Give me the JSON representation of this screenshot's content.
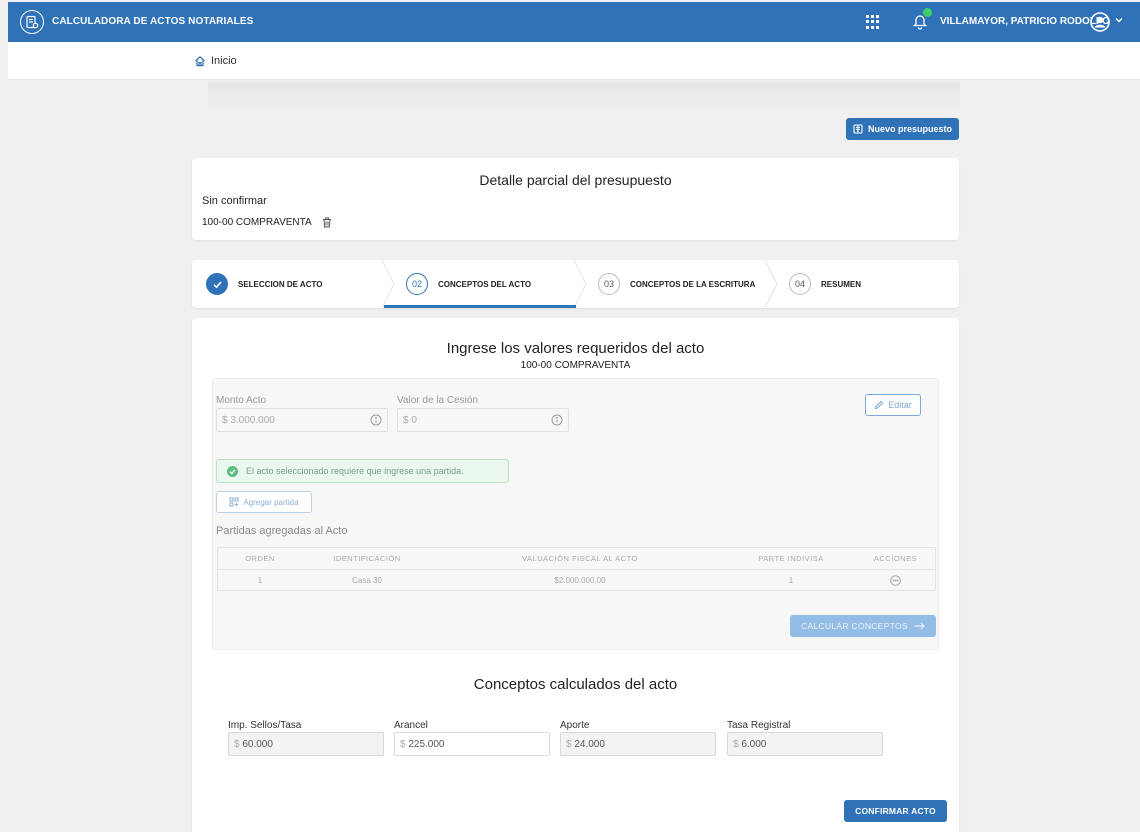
{
  "header": {
    "app_title": "CALCULADORA DE ACTOS NOTARIALES",
    "user_name": "VILLAMAYOR, PATRICIO RODOLFO"
  },
  "breadcrumb": {
    "home_label": "Inicio"
  },
  "actions": {
    "new_budget_label": "Nuevo presupuesto"
  },
  "summary": {
    "title": "Detalle parcial del presupuesto",
    "status": "Sin confirmar",
    "act_label": "100-00 COMPRAVENTA"
  },
  "stepper": {
    "steps": [
      {
        "number": "",
        "label": "SELECCION DE ACTO",
        "state": "done"
      },
      {
        "number": "02",
        "label": "CONCEPTOS DEL ACTO",
        "state": "active"
      },
      {
        "number": "03",
        "label": "CONCEPTOS DE LA ESCRITURA",
        "state": "pending"
      },
      {
        "number": "04",
        "label": "RESUMEN",
        "state": "pending"
      }
    ]
  },
  "form": {
    "heading": "Ingrese los valores requeridos del acto",
    "subheading": "100-00 COMPRAVENTA",
    "monto_label": "Monto Acto",
    "monto_currency": "$",
    "monto_value": "3.000.000",
    "cesion_label": "Valor de la Cesión",
    "cesion_currency": "$",
    "cesion_value": "0",
    "edit_label": "Editar",
    "alert_text": "El acto seleccionado requiere que ingrese una partida.",
    "add_partida_label": "Agregar partida",
    "partidas_title": "Partidas agregadas al Acto",
    "table": {
      "headers": [
        "ORDEN",
        "IDENTIFICACIÓN",
        "VALUACIÓN FISCAL AL ACTO",
        "PARTE INDIVISA",
        "ACCIONES"
      ],
      "rows": [
        {
          "orden": "1",
          "identificacion": "Casa 30",
          "valuacion": "$2.000.000,00",
          "parte": "1"
        }
      ]
    },
    "calc_label": "CALCULAR CONCEPTOS"
  },
  "concepts": {
    "heading": "Conceptos calculados del acto",
    "items": [
      {
        "label": "Imp. Sellos/Tasa",
        "currency": "$",
        "value": "60.000"
      },
      {
        "label": "Arancel",
        "currency": "$",
        "value": "225.000"
      },
      {
        "label": "Aporte",
        "currency": "$",
        "value": "24.000"
      },
      {
        "label": "Tasa Registral",
        "currency": "$",
        "value": "6.000"
      }
    ],
    "confirm_label": "CONFIRMAR ACTO"
  },
  "colors": {
    "primary": "#2f72b8",
    "success": "#3fcf6a",
    "background": "#f0f0f0"
  }
}
